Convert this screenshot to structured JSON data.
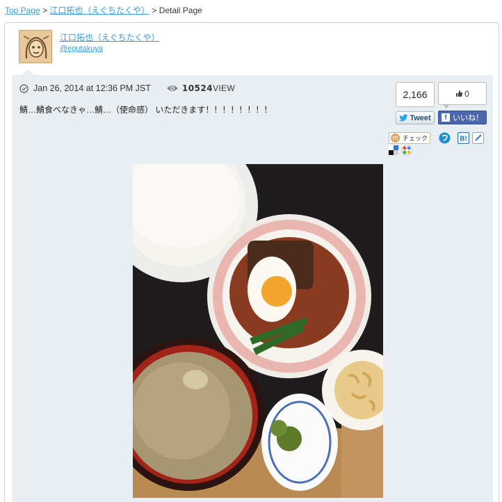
{
  "breadcrumb": {
    "top": "Top Page",
    "sep1": ">",
    "user": "江口拓也（えぐちたくや）",
    "sep2": ">",
    "current": "Detail Page"
  },
  "user": {
    "name": "江口拓也（えぐちたくや）",
    "handle": "@egutakuya"
  },
  "post": {
    "date": "Jan 26, 2014 at 12:36 PM JST",
    "view_count": "10524",
    "view_label": "VIEW",
    "text": "鯖…鯖食べなきゃ…鯖…（使命感） いただきます！！！！！！！！"
  },
  "social": {
    "tweet_count": "2,166",
    "tweet_label": "Tweet",
    "like_count": "0",
    "fb_label": "いいね！",
    "mixi_label": "チェック"
  },
  "colors": {
    "link": "#3a9ad9",
    "post_bg": "#e9eef3",
    "facebook": "#4a67ad",
    "twitter": "#1da1f2"
  }
}
